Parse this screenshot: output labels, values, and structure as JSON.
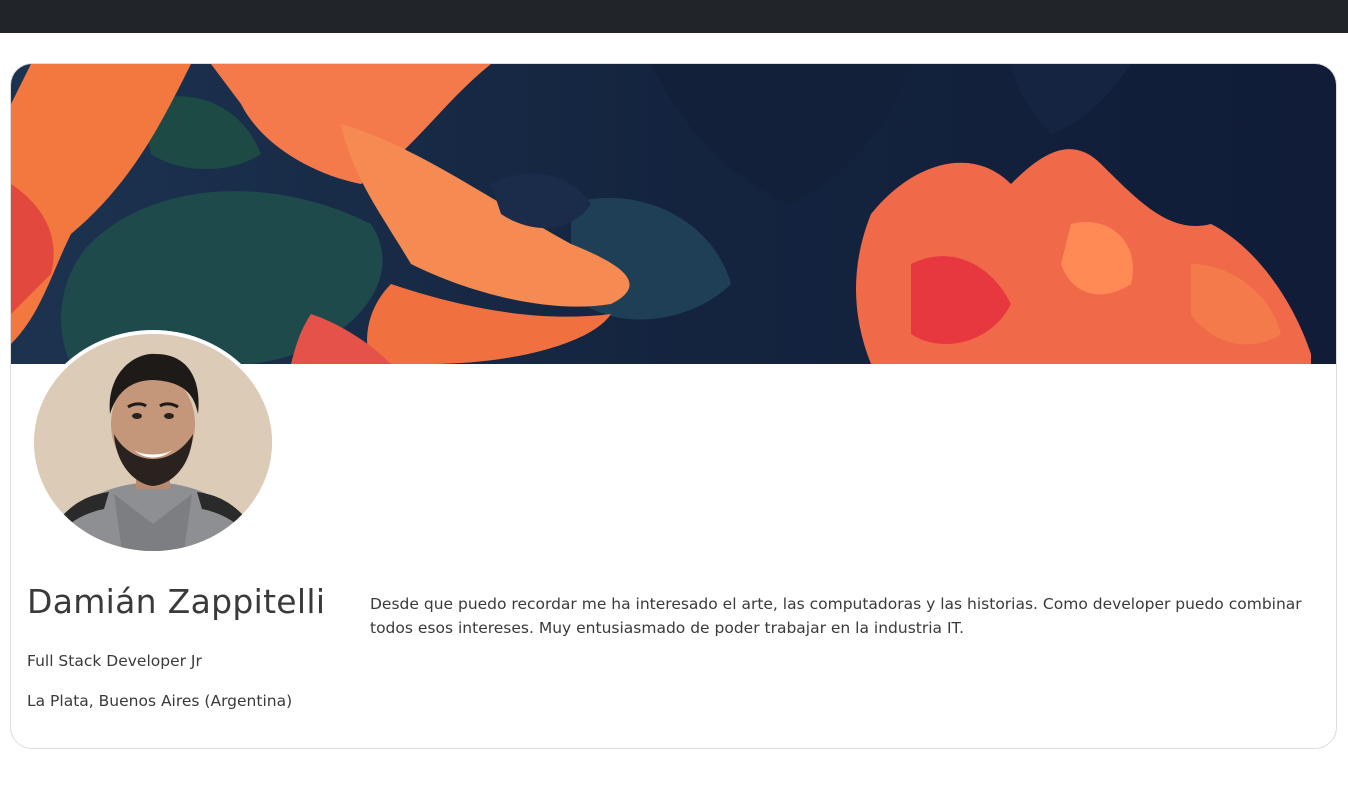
{
  "profile": {
    "name": "Damián Zappitelli",
    "role": "Full Stack Developer Jr",
    "location": "La Plata, Buenos Aires (Argentina)",
    "bio": "Desde que puedo recordar me ha interesado el arte, las computadoras y las historias. Como developer puedo combinar todos esos intereses. Muy entusiasmado de poder trabajar en la industria IT."
  },
  "theme": {
    "topbar_color": "#212529",
    "banner_dark": "#1b2a4a",
    "banner_orange": "#ff7a45",
    "banner_red": "#ff4a4a",
    "banner_teal": "#1f4a4f"
  }
}
